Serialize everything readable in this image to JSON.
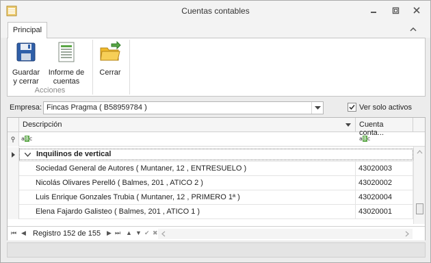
{
  "window": {
    "title": "Cuentas contables"
  },
  "ribbon": {
    "tab": "Principal",
    "buttons": {
      "guardar_line1": "Guardar",
      "guardar_line2": "y cerrar",
      "informe_line1": "Informe de",
      "informe_line2": "cuentas",
      "cerrar": "Cerrar"
    },
    "group_label": "Acciones"
  },
  "filter": {
    "empresa_label": "Empresa:",
    "empresa_value": "Fincas Pragma ( B58959784 )",
    "ver_solo_activos_label": "Ver solo activos",
    "ver_solo_activos_checked": true
  },
  "grid": {
    "columns": [
      "Descripción",
      "Cuenta conta..."
    ],
    "group_title": "Inquilinos de vertical",
    "rows": [
      {
        "descripcion": "Sociedad General de Autores ( Muntaner, 12 , ENTRESUELO )",
        "cuenta": "43020003"
      },
      {
        "descripcion": "Nicolás Olivares Perelló ( Balmes, 201 , ATICO 2 )",
        "cuenta": "43020002"
      },
      {
        "descripcion": "Luis Enrique Gonzales Trubia ( Muntaner, 12 , PRIMERO 1ª )",
        "cuenta": "43020004"
      },
      {
        "descripcion": "Elena Fajardo Galisteo ( Balmes, 201 , ATICO 1 )",
        "cuenta": "43020001"
      }
    ],
    "navigator": {
      "record_text": "Registro 152 de 155"
    }
  },
  "icons": [
    "app-icon",
    "minimize-icon",
    "restore-icon",
    "close-icon",
    "collapse-ribbon-icon",
    "save-icon",
    "report-icon",
    "exit-icon",
    "dropdown-icon",
    "filter-pin-icon",
    "abc-filter-icon",
    "expand-icon",
    "sort-desc-icon"
  ],
  "colors": {
    "accent_green": "#5aa646",
    "folder_yellow": "#f0b92a",
    "save_blue": "#2f5fa8"
  }
}
